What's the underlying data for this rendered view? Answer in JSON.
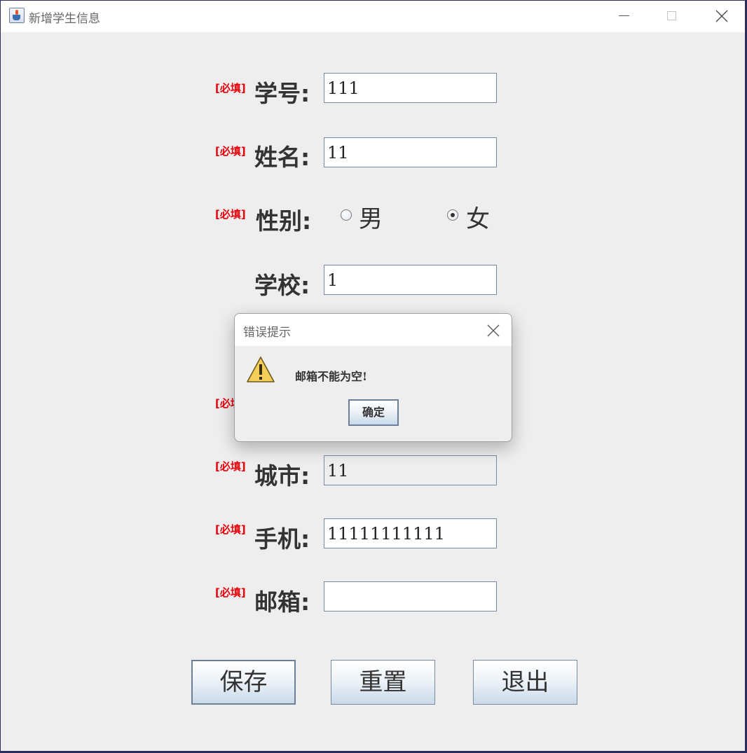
{
  "window": {
    "title": "新增学生信息"
  },
  "form": {
    "required_mark": "[必填]",
    "student_id": {
      "label": "学号:",
      "value": "111"
    },
    "name": {
      "label": "姓名:",
      "value": "11"
    },
    "gender": {
      "label": "性别:",
      "options": [
        "男",
        "女"
      ],
      "selected": "女"
    },
    "school": {
      "label": "学校:",
      "value": "1"
    },
    "city": {
      "label": "城市:",
      "value": "11"
    },
    "phone": {
      "label": "手机:",
      "value": "11111111111"
    },
    "email": {
      "label": "邮箱:",
      "value": ""
    }
  },
  "buttons": {
    "save": "保存",
    "reset": "重置",
    "exit": "退出"
  },
  "dialog": {
    "title": "错误提示",
    "message": "邮箱不能为空!",
    "ok": "确定",
    "icon": "warning-icon"
  },
  "colors": {
    "required": "#e8000b",
    "window_bg": "#eeeeee"
  }
}
